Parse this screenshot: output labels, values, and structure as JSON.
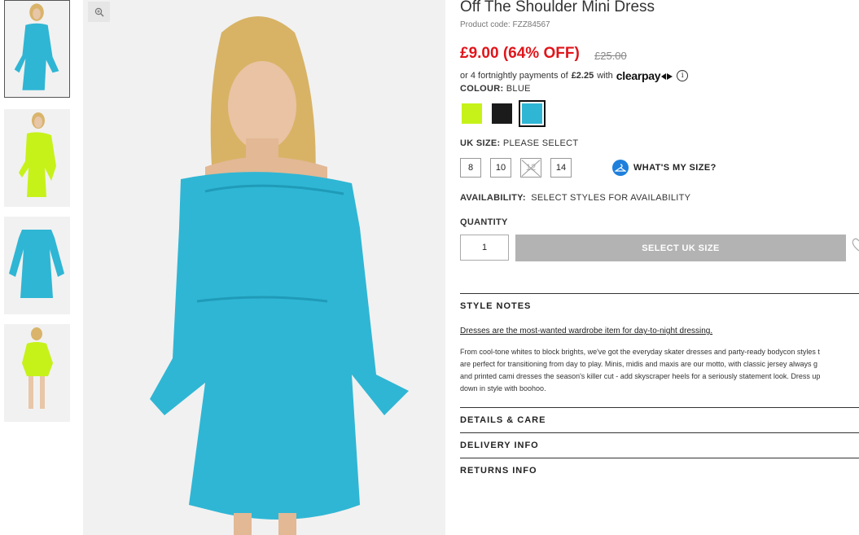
{
  "gallery": {
    "thumbnails": [
      {
        "alt": "blue-dress-thumbnail",
        "active": true
      },
      {
        "alt": "neon-dress-thumbnail",
        "active": false
      },
      {
        "alt": "blue-dress-flatlay-thumbnail",
        "active": false
      },
      {
        "alt": "neon-dress-full-thumbnail",
        "active": false
      }
    ],
    "zoom_icon": "zoom-icon"
  },
  "product": {
    "title": "Off The Shoulder Mini Dress",
    "code": "Product code: FZZ84567",
    "price_now": "£9.00 (64% OFF)",
    "price_was": "£25.00",
    "payments_prefix": "or 4 fortnightly payments of",
    "payments_amount": "£2.25",
    "payments_with": "with",
    "clearpay_logo": "clearpay",
    "info_glyph": "i"
  },
  "colour": {
    "label": "COLOUR:",
    "value": "BLUE",
    "swatches": [
      {
        "name": "neon-lime",
        "color": "#c6f21a"
      },
      {
        "name": "black",
        "color": "#1b1b1b"
      },
      {
        "name": "blue",
        "color": "#2fb6d4",
        "selected": true
      }
    ]
  },
  "size": {
    "label": "UK SIZE:",
    "value": "PLEASE SELECT",
    "options": [
      "8",
      "10",
      "12",
      "14"
    ],
    "disabled": [
      "12"
    ],
    "whats_my_size": "WHAT'S MY SIZE?"
  },
  "availability": {
    "label": "AVAILABILITY:",
    "value": "SELECT STYLES FOR AVAILABILITY"
  },
  "quantity": {
    "label": "QUANTITY",
    "value": "1",
    "button": "SELECT UK SIZE"
  },
  "style_notes": {
    "heading": "STYLE NOTES",
    "lead": "Dresses are the most-wanted wardrobe item for day-to-night dressing.",
    "lines": [
      "From cool-tone whites to block brights, we've got the everyday skater dresses and party-ready bodycon styles t",
      "are perfect for transitioning from day to play. Minis, midis and maxis are our motto, with classic jersey always g",
      "and printed cami dresses the season's killer cut - add skyscraper heels for a seriously statement look. Dress up",
      "down in style with boohoo."
    ]
  },
  "accordions": [
    "DETAILS & CARE",
    "DELIVERY INFO",
    "RETURNS INFO"
  ],
  "colors": {
    "sale_red": "#e0151b",
    "button_grey": "#b3b3b3",
    "dress_blue": "#2fb6d4",
    "hanger_blue": "#1e7fdc"
  }
}
